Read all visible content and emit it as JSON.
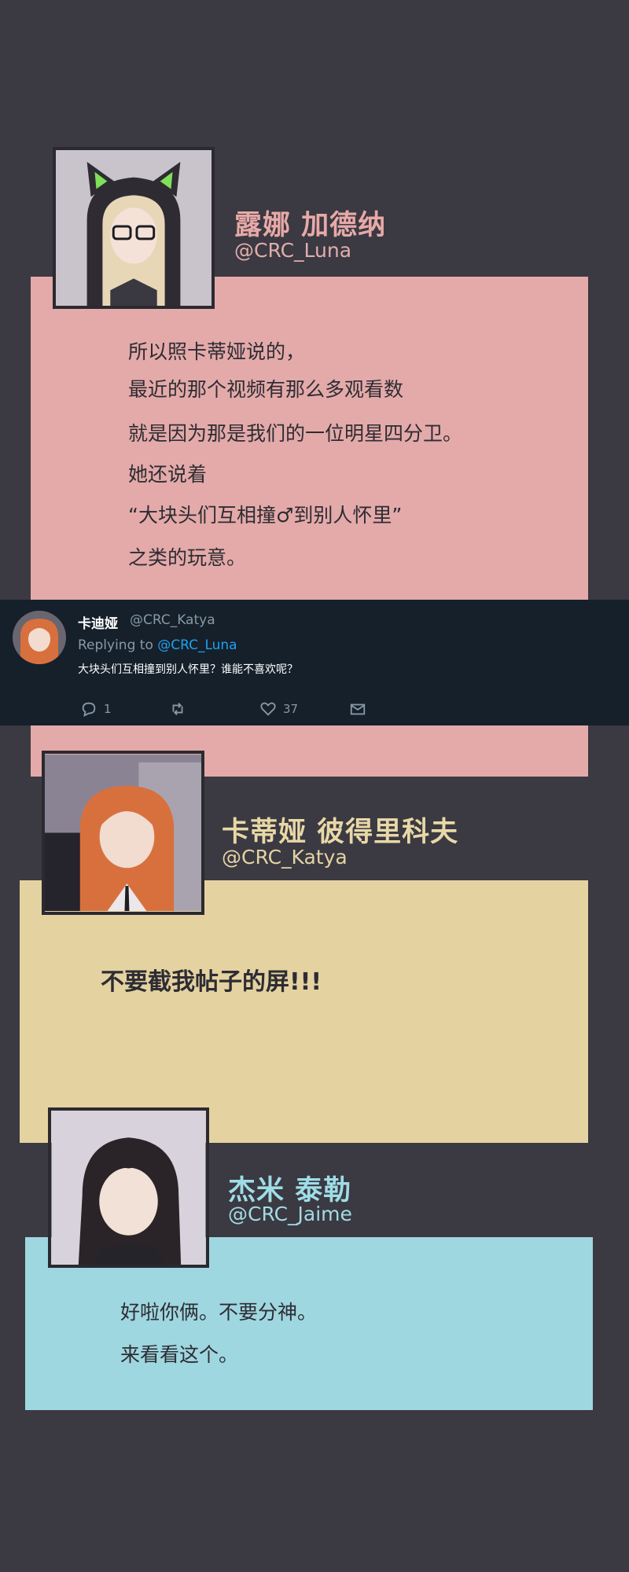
{
  "colors": {
    "background": "#3b3942",
    "luna_card": "#e3aaa9",
    "luna_name": "#e7a9a7",
    "katya_card": "#e4d3a1",
    "katya_name": "#e8d8a6",
    "jaime_card": "#9fd7e0",
    "jaime_name": "#9fdde6",
    "tweet_bg": "#15202b"
  },
  "luna": {
    "name": "露娜 加德纳",
    "handle": "@CRC_Luna",
    "avatar_icon": "luna-avatar",
    "lines": [
      "所以照卡蒂娅说的，",
      "最近的那个视频有那么多观看数",
      "就是因为那是我们的一位明星四分卫。",
      "她还说着",
      "“大块头们互相撞♂到别人怀里”",
      "之类的玩意。"
    ]
  },
  "tweet": {
    "name": "卡迪娅",
    "handle": "@CRC_Katya",
    "replying_prefix": "Replying to ",
    "replying_to": "@CRC_Luna",
    "text": "大块头们互相撞到别人怀里？谁能不喜欢呢？",
    "reply_count": "1",
    "retweet_count": "",
    "like_count": "37"
  },
  "katya": {
    "name": "卡蒂娅  彼得里科夫",
    "handle": "@CRC_Katya",
    "avatar_icon": "katya-avatar",
    "lines": [
      "不要截我帖子的屏!!!"
    ]
  },
  "jaime": {
    "name": "杰米  泰勒",
    "handle": "@CRC_Jaime",
    "avatar_icon": "jaime-avatar",
    "lines": [
      "好啦你俩。不要分神。",
      "来看看这个。"
    ]
  }
}
